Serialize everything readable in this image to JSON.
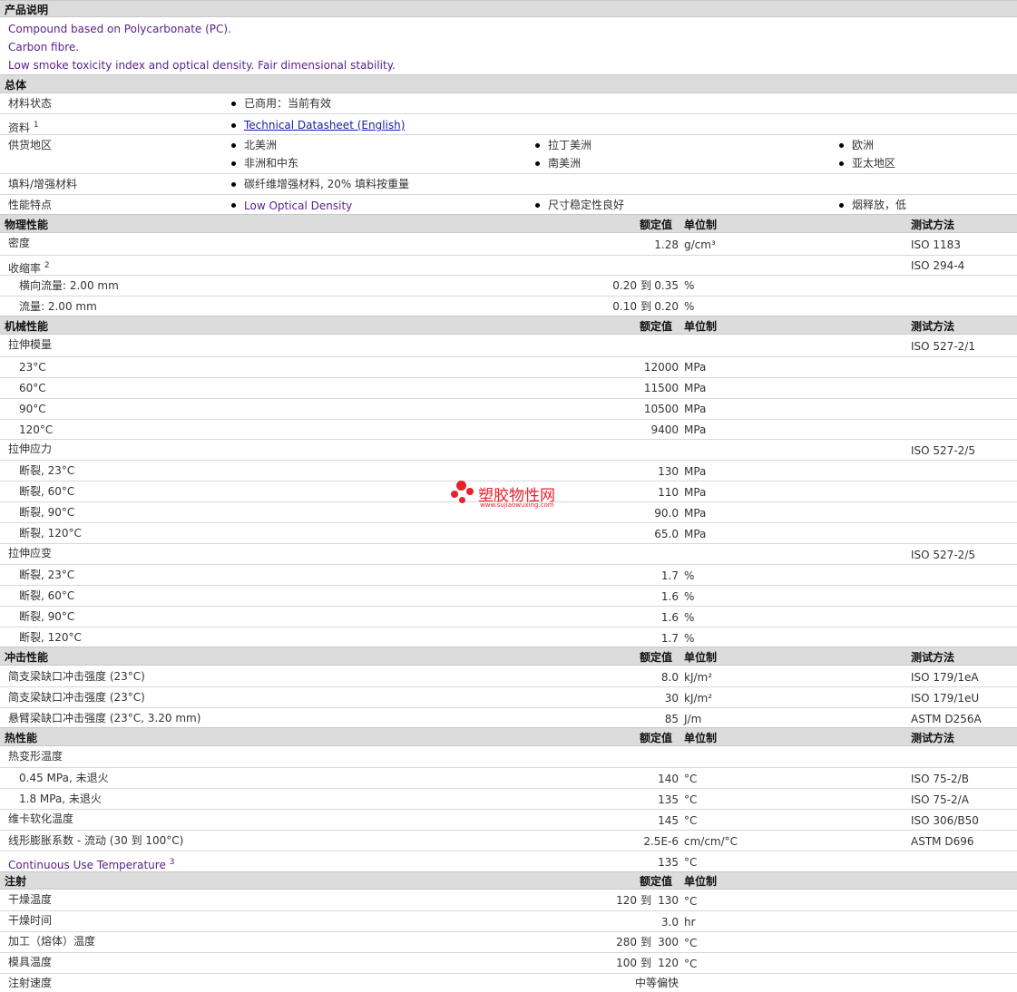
{
  "sections": {
    "desc": "产品说明",
    "general": "总体",
    "physical": "物理性能",
    "mechanical": "机械性能",
    "impact": "冲击性能",
    "thermal": "热性能",
    "injection": "注射"
  },
  "headers": {
    "nominal": "额定值",
    "unit": "单位制",
    "method": "测试方法"
  },
  "description": [
    "Compound based on Polycarbonate (PC).",
    "Carbon fibre.",
    "Low smoke toxicity index and optical density. Fair dimensional stability."
  ],
  "general": {
    "status_label": "材料状态",
    "status_value": "已商用：当前有效",
    "doc_label": "资料",
    "doc_sup": "1",
    "doc_link": "Technical Datasheet (English)",
    "region_label": "供货地区",
    "regions": [
      "北美洲",
      "拉丁美洲",
      "欧洲",
      "非洲和中东",
      "南美洲",
      "亚太地区"
    ],
    "filler_label": "填料/增强材料",
    "filler_value": "碳纤维增强材料, 20% 填料按重量",
    "feature_label": "性能特点",
    "features": [
      "Low Optical Density",
      "尺寸稳定性良好",
      "烟释放，低"
    ]
  },
  "range_word": "到",
  "physical": {
    "density": {
      "label": "密度",
      "value": "1.28",
      "unit": "g/cm³",
      "method": "ISO 1183"
    },
    "shrink": {
      "label": "收缩率",
      "sup": "2",
      "method": "ISO 294-4"
    },
    "shrink_rows": [
      {
        "label": "横向流量: 2.00 mm",
        "from": "0.20",
        "to": "0.35",
        "unit": "%"
      },
      {
        "label": "流量: 2.00 mm",
        "from": "0.10",
        "to": "0.20",
        "unit": "%"
      }
    ]
  },
  "mechanical": {
    "modulus": {
      "label": "拉伸模量",
      "method": "ISO 527-2/1"
    },
    "modulus_rows": [
      {
        "label": "23°C",
        "value": "12000",
        "unit": "MPa"
      },
      {
        "label": "60°C",
        "value": "11500",
        "unit": "MPa"
      },
      {
        "label": "90°C",
        "value": "10500",
        "unit": "MPa"
      },
      {
        "label": "120°C",
        "value": "9400",
        "unit": "MPa"
      }
    ],
    "stress": {
      "label": "拉伸应力",
      "method": "ISO 527-2/5"
    },
    "stress_rows": [
      {
        "label": "断裂, 23°C",
        "value": "130",
        "unit": "MPa"
      },
      {
        "label": "断裂, 60°C",
        "value": "110",
        "unit": "MPa"
      },
      {
        "label": "断裂, 90°C",
        "value": "90.0",
        "unit": "MPa"
      },
      {
        "label": "断裂, 120°C",
        "value": "65.0",
        "unit": "MPa"
      }
    ],
    "strain": {
      "label": "拉伸应变",
      "method": "ISO 527-2/5"
    },
    "strain_rows": [
      {
        "label": "断裂, 23°C",
        "value": "1.7",
        "unit": "%"
      },
      {
        "label": "断裂, 60°C",
        "value": "1.6",
        "unit": "%"
      },
      {
        "label": "断裂, 90°C",
        "value": "1.6",
        "unit": "%"
      },
      {
        "label": "断裂, 120°C",
        "value": "1.7",
        "unit": "%"
      }
    ]
  },
  "impact": [
    {
      "label": "简支梁缺口冲击强度",
      "cond": "(23°C)",
      "value": "8.0",
      "unit": "kJ/m²",
      "method": "ISO 179/1eA"
    },
    {
      "label": "简支梁缺口冲击强度",
      "cond": "(23°C)",
      "value": "30",
      "unit": "kJ/m²",
      "method": "ISO 179/1eU"
    },
    {
      "label": "悬臂梁缺口冲击强度",
      "cond": "(23°C, 3.20 mm)",
      "value": "85",
      "unit": "J/m",
      "method": "ASTM D256A"
    }
  ],
  "thermal": {
    "hdt_label": "热变形温度",
    "hdt_rows": [
      {
        "label": "0.45 MPa, 未退火",
        "value": "140",
        "unit": "°C",
        "method": "ISO 75-2/B"
      },
      {
        "label": "1.8 MPa, 未退火",
        "value": "135",
        "unit": "°C",
        "method": "ISO 75-2/A"
      }
    ],
    "vicat": {
      "label": "维卡软化温度",
      "value": "145",
      "unit": "°C",
      "method": "ISO 306/B50"
    },
    "clte": {
      "label": "线形膨胀系数 - 流动",
      "cond": "(30 到 100°C)",
      "value": "2.5E-6",
      "unit": "cm/cm/°C",
      "method": "ASTM D696"
    },
    "cut": {
      "label": "Continuous Use Temperature",
      "sup": "3",
      "value": "135",
      "unit": "°C"
    }
  },
  "injection": {
    "dry_temp": {
      "label": "干燥温度",
      "from": "120",
      "to": "130",
      "unit": "°C"
    },
    "dry_time": {
      "label": "干燥时间",
      "value": "3.0",
      "unit": "hr"
    },
    "melt_temp": {
      "label": "加工（熔体）温度",
      "from": "280",
      "to": "300",
      "unit": "°C"
    },
    "mold_temp": {
      "label": "模具温度",
      "from": "100",
      "to": "120",
      "unit": "°C"
    },
    "speed": {
      "label": "注射速度",
      "value": "中等偏快"
    }
  },
  "watermark": {
    "name": "塑胶物性网",
    "url": "www.sujiaowuxing.com"
  }
}
